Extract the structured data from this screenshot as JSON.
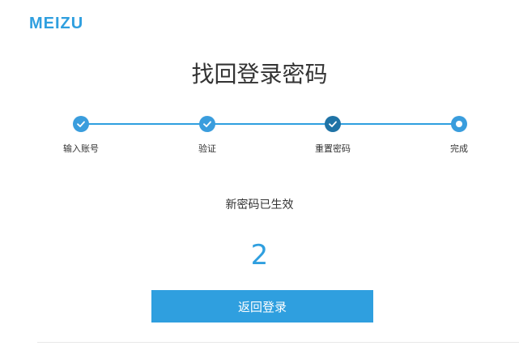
{
  "brand": {
    "logo_text": "MEIZU",
    "accent_color": "#2f9fdf"
  },
  "page": {
    "title": "找回登录密码"
  },
  "stepper": {
    "steps": [
      {
        "label": "输入账号",
        "state": "done",
        "icon": "check-icon"
      },
      {
        "label": "验证",
        "state": "done",
        "icon": "check-icon"
      },
      {
        "label": "重置密码",
        "state": "current",
        "icon": "check-icon"
      },
      {
        "label": "完成",
        "state": "pending",
        "icon": "dot-icon"
      }
    ]
  },
  "result": {
    "message": "新密码已生效",
    "countdown": "2"
  },
  "actions": {
    "back_to_login_label": "返回登录"
  }
}
